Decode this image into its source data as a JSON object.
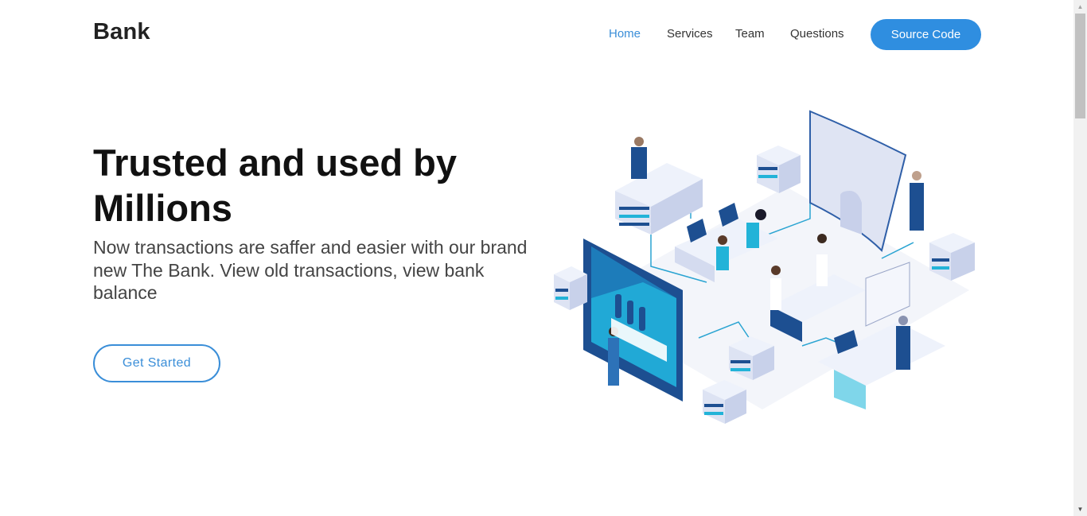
{
  "header": {
    "brand": "Bank",
    "nav": [
      {
        "label": "Home",
        "active": true
      },
      {
        "label": "Services",
        "active": false
      },
      {
        "label": "Team",
        "active": false
      },
      {
        "label": "Questions",
        "active": false
      }
    ],
    "cta_label": "Source Code"
  },
  "hero": {
    "title": "Trusted and used by Millions",
    "subtitle": "Now transactions are saffer and easier with our brand new The Bank. View old transactions, view bank balance",
    "button_label": "Get Started"
  },
  "colors": {
    "accent": "#2f8ee0",
    "dark_blue": "#1d4f91",
    "cyan": "#22b3d8"
  }
}
